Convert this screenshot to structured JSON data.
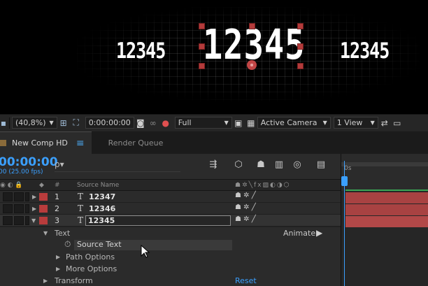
{
  "viewer": {
    "left_text": "12345",
    "center_text": "12345",
    "right_text": "12345"
  },
  "viewer_toolbar": {
    "magnification": "(40,8%)",
    "timecode": "0:00:00:00",
    "resolution": "Full",
    "camera": "Active Camera",
    "view_layout": "1 View"
  },
  "tabs": [
    {
      "label": "New Comp HD",
      "active": true
    },
    {
      "label": "Render Queue",
      "active": false
    }
  ],
  "timeline": {
    "timecode": "00:00:00",
    "fps": "00 (25.00 fps)",
    "search_placeholder": "ρ▾",
    "ruler_label": "0s"
  },
  "columns": {
    "num": "#",
    "source_name": "Source Name"
  },
  "layers": [
    {
      "num": "1",
      "name": "12347",
      "selected": false
    },
    {
      "num": "2",
      "name": "12346",
      "selected": false
    },
    {
      "num": "3",
      "name": "12345",
      "selected": true
    }
  ],
  "properties": {
    "text_group": "Text",
    "animate_label": "Animate:",
    "source_text": "Source Text",
    "path_options": "Path Options",
    "more_options": "More Options",
    "transform": "Transform",
    "reset": "Reset"
  },
  "colors": {
    "accent_blue": "#3ba0ff",
    "layer_label_red": "#b83c3c",
    "layer_bar": "#a84242"
  }
}
